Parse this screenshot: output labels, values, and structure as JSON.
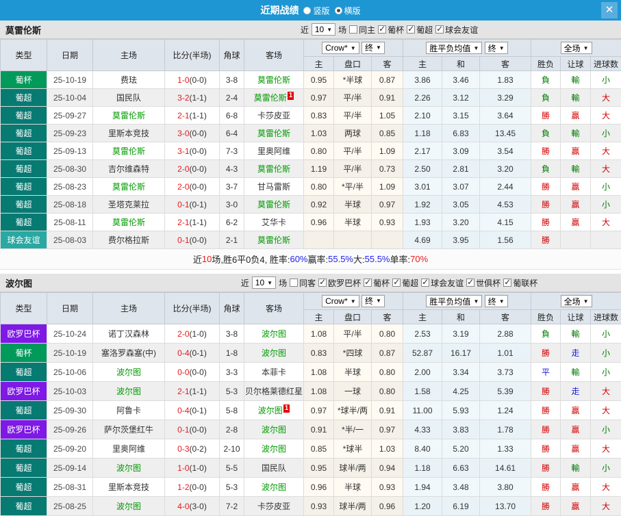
{
  "titlebar": {
    "title": "近期战绩",
    "radios": [
      {
        "label": "竖版",
        "checked": false
      },
      {
        "label": "横版",
        "checked": true
      }
    ],
    "close_label": "✕"
  },
  "table_header": {
    "type": "类型",
    "date": "日期",
    "home": "主场",
    "score": "比分(半场)",
    "corner": "角球",
    "away": "客场",
    "sub": [
      "主",
      "盘口",
      "客",
      "主",
      "和",
      "客",
      "胜负",
      "让球",
      "进球数"
    ],
    "dropdowns": [
      "Crow*",
      "终",
      "胜平负均值",
      "终",
      "全场"
    ]
  },
  "filter_labels": {
    "near": "近",
    "matches": "场"
  },
  "comp_colors": {
    "葡杯": "#029a5b",
    "葡超": "#077a72",
    "球会友谊": "#2aa8a2",
    "欧罗巴杯": "#7e19e6"
  },
  "result_colors": {
    "勝": "#d40000",
    "贏": "#d40000",
    "大": "#d40000",
    "負": "#007a00",
    "輸": "#007a00",
    "小": "#007a00",
    "平": "#1a1ad4",
    "走": "#1a1ad4"
  },
  "sections": [
    {
      "team": "莫雷伦斯",
      "filter": {
        "count": "10",
        "same_label": "同主",
        "same_checked": false,
        "comps": [
          "葡杯",
          "葡超",
          "球会友谊"
        ]
      },
      "rows": [
        {
          "type": "葡杯",
          "date": "25-10-19",
          "home": "费珐",
          "score": "1-0",
          "half": "(0-0)",
          "corner": "3-8",
          "away": "莫雷伦斯",
          "away_focus": true,
          "o1": "0.95",
          "pan": "*半球",
          "o2": "0.87",
          "a1": "3.86",
          "a2": "3.46",
          "a3": "1.83",
          "res": "負",
          "let": "輸",
          "goal": "小"
        },
        {
          "type": "葡超",
          "date": "25-10-04",
          "home": "国民队",
          "score": "3-2",
          "half": "(1-1)",
          "corner": "2-4",
          "away": "莫雷伦斯",
          "away_focus": true,
          "away_badge": "1",
          "o1": "0.97",
          "pan": "平/半",
          "o2": "0.91",
          "a1": "2.26",
          "a2": "3.12",
          "a3": "3.29",
          "res": "負",
          "let": "輸",
          "goal": "大"
        },
        {
          "type": "葡超",
          "date": "25-09-27",
          "home": "莫雷伦斯",
          "home_focus": true,
          "score": "2-1",
          "half": "(1-1)",
          "corner": "6-8",
          "away": "卡莎皮亚",
          "o1": "0.83",
          "pan": "平/半",
          "o2": "1.05",
          "a1": "2.10",
          "a2": "3.15",
          "a3": "3.64",
          "res": "勝",
          "let": "贏",
          "goal": "大"
        },
        {
          "type": "葡超",
          "date": "25-09-23",
          "home": "里斯本竞技",
          "score": "3-0",
          "half": "(0-0)",
          "corner": "6-4",
          "away": "莫雷伦斯",
          "away_focus": true,
          "o1": "1.03",
          "pan": "两球",
          "o2": "0.85",
          "a1": "1.18",
          "a2": "6.83",
          "a3": "13.45",
          "res": "負",
          "let": "輸",
          "goal": "小"
        },
        {
          "type": "葡超",
          "date": "25-09-13",
          "home": "莫雷伦斯",
          "home_focus": true,
          "score": "3-1",
          "half": "(0-0)",
          "corner": "7-3",
          "away": "里奥阿维",
          "o1": "0.80",
          "pan": "平/半",
          "o2": "1.09",
          "a1": "2.17",
          "a2": "3.09",
          "a3": "3.54",
          "res": "勝",
          "let": "贏",
          "goal": "大"
        },
        {
          "type": "葡超",
          "date": "25-08-30",
          "home": "吉尔维森特",
          "score": "2-0",
          "half": "(0-0)",
          "corner": "4-3",
          "away": "莫雷伦斯",
          "away_focus": true,
          "o1": "1.19",
          "pan": "平/半",
          "o2": "0.73",
          "a1": "2.50",
          "a2": "2.81",
          "a3": "3.20",
          "res": "負",
          "let": "輸",
          "goal": "大"
        },
        {
          "type": "葡超",
          "date": "25-08-23",
          "home": "莫雷伦斯",
          "home_focus": true,
          "score": "2-0",
          "half": "(0-0)",
          "corner": "3-7",
          "away": "甘马雷斯",
          "o1": "0.80",
          "pan": "*平/半",
          "o2": "1.09",
          "a1": "3.01",
          "a2": "3.07",
          "a3": "2.44",
          "res": "勝",
          "let": "贏",
          "goal": "小"
        },
        {
          "type": "葡超",
          "date": "25-08-18",
          "home": "圣塔克莱拉",
          "score": "0-1",
          "half": "(0-1)",
          "corner": "3-0",
          "away": "莫雷伦斯",
          "away_focus": true,
          "o1": "0.92",
          "pan": "半球",
          "o2": "0.97",
          "a1": "1.92",
          "a2": "3.05",
          "a3": "4.53",
          "res": "勝",
          "let": "贏",
          "goal": "小"
        },
        {
          "type": "葡超",
          "date": "25-08-11",
          "home": "莫雷伦斯",
          "home_focus": true,
          "score": "2-1",
          "half": "(1-1)",
          "corner": "6-2",
          "away": "艾华卡",
          "o1": "0.96",
          "pan": "半球",
          "o2": "0.93",
          "a1": "1.93",
          "a2": "3.20",
          "a3": "4.15",
          "res": "勝",
          "let": "贏",
          "goal": "大"
        },
        {
          "type": "球会友谊",
          "date": "25-08-03",
          "home": "费尔格拉斯",
          "score": "0-1",
          "half": "(0-0)",
          "corner": "2-1",
          "away": "莫雷伦斯",
          "away_focus": true,
          "o1": "",
          "pan": "",
          "o2": "",
          "a1": "4.69",
          "a2": "3.95",
          "a3": "1.56",
          "res": "勝",
          "let": "",
          "goal": ""
        }
      ],
      "summary": [
        [
          "近",
          "k"
        ],
        [
          "10",
          "r"
        ],
        [
          "场,胜6平0负4, 胜率:",
          "k"
        ],
        [
          "60%",
          "b"
        ],
        [
          " 赢率:",
          "k"
        ],
        [
          "55.5%",
          "b"
        ],
        [
          " 大:",
          "k"
        ],
        [
          "55.5%",
          "b"
        ],
        [
          " 单率:",
          "k"
        ],
        [
          "70%",
          "r"
        ]
      ]
    },
    {
      "team": "波尔图",
      "filter": {
        "count": "10",
        "same_label": "同客",
        "same_checked": false,
        "comps": [
          "欧罗巴杯",
          "葡杯",
          "葡超",
          "球会友谊",
          "世俱杯",
          "葡联杯"
        ]
      },
      "rows": [
        {
          "type": "欧罗巴杯",
          "date": "25-10-24",
          "home": "诺丁汉森林",
          "score": "2-0",
          "half": "(1-0)",
          "corner": "3-8",
          "away": "波尔图",
          "away_focus": true,
          "o1": "1.08",
          "pan": "平/半",
          "o2": "0.80",
          "a1": "2.53",
          "a2": "3.19",
          "a3": "2.88",
          "res": "負",
          "let": "輸",
          "goal": "小"
        },
        {
          "type": "葡杯",
          "date": "25-10-19",
          "home": "塞洛罗森塞(中)",
          "score": "0-4",
          "half": "(0-1)",
          "corner": "1-8",
          "away": "波尔图",
          "away_focus": true,
          "o1": "0.83",
          "pan": "*四球",
          "o2": "0.87",
          "a1": "52.87",
          "a2": "16.17",
          "a3": "1.01",
          "res": "勝",
          "let": "走",
          "goal": "小"
        },
        {
          "type": "葡超",
          "date": "25-10-06",
          "home": "波尔图",
          "home_focus": true,
          "score": "0-0",
          "half": "(0-0)",
          "corner": "3-3",
          "away": "本菲卡",
          "o1": "1.08",
          "pan": "半球",
          "o2": "0.80",
          "a1": "2.00",
          "a2": "3.34",
          "a3": "3.73",
          "res": "平",
          "let": "輸",
          "goal": "小"
        },
        {
          "type": "欧罗巴杯",
          "date": "25-10-03",
          "home": "波尔图",
          "home_focus": true,
          "score": "2-1",
          "half": "(1-1)",
          "corner": "5-3",
          "away": "贝尔格莱德红星",
          "o1": "1.08",
          "pan": "一球",
          "o2": "0.80",
          "a1": "1.58",
          "a2": "4.25",
          "a3": "5.39",
          "res": "勝",
          "let": "走",
          "goal": "大"
        },
        {
          "type": "葡超",
          "date": "25-09-30",
          "home": "阿鲁卡",
          "score": "0-4",
          "half": "(0-1)",
          "corner": "5-8",
          "away": "波尔图",
          "away_focus": true,
          "away_badge": "1",
          "o1": "0.97",
          "pan": "*球半/两",
          "o2": "0.91",
          "a1": "11.00",
          "a2": "5.93",
          "a3": "1.24",
          "res": "勝",
          "let": "贏",
          "goal": "大"
        },
        {
          "type": "欧罗巴杯",
          "date": "25-09-26",
          "home": "萨尔茨堡红牛",
          "score": "0-1",
          "half": "(0-0)",
          "corner": "2-8",
          "away": "波尔图",
          "away_focus": true,
          "o1": "0.91",
          "pan": "*半/一",
          "o2": "0.97",
          "a1": "4.33",
          "a2": "3.83",
          "a3": "1.78",
          "res": "勝",
          "let": "贏",
          "goal": "小"
        },
        {
          "type": "葡超",
          "date": "25-09-20",
          "home": "里奥阿维",
          "score": "0-3",
          "half": "(0-2)",
          "corner": "2-10",
          "away": "波尔图",
          "away_focus": true,
          "o1": "0.85",
          "pan": "*球半",
          "o2": "1.03",
          "a1": "8.40",
          "a2": "5.20",
          "a3": "1.33",
          "res": "勝",
          "let": "贏",
          "goal": "大"
        },
        {
          "type": "葡超",
          "date": "25-09-14",
          "home": "波尔图",
          "home_focus": true,
          "score": "1-0",
          "half": "(1-0)",
          "corner": "5-5",
          "away": "国民队",
          "o1": "0.95",
          "pan": "球半/两",
          "o2": "0.94",
          "a1": "1.18",
          "a2": "6.63",
          "a3": "14.61",
          "res": "勝",
          "let": "輸",
          "goal": "小"
        },
        {
          "type": "葡超",
          "date": "25-08-31",
          "home": "里斯本竞技",
          "score": "1-2",
          "half": "(0-0)",
          "corner": "5-3",
          "away": "波尔图",
          "away_focus": true,
          "o1": "0.96",
          "pan": "半球",
          "o2": "0.93",
          "a1": "1.94",
          "a2": "3.48",
          "a3": "3.80",
          "res": "勝",
          "let": "贏",
          "goal": "大"
        },
        {
          "type": "葡超",
          "date": "25-08-25",
          "home": "波尔图",
          "home_focus": true,
          "score": "4-0",
          "half": "(3-0)",
          "corner": "7-2",
          "away": "卡莎皮亚",
          "o1": "0.93",
          "pan": "球半/两",
          "o2": "0.96",
          "a1": "1.20",
          "a2": "6.19",
          "a3": "13.70",
          "res": "勝",
          "let": "贏",
          "goal": "大"
        }
      ]
    }
  ]
}
